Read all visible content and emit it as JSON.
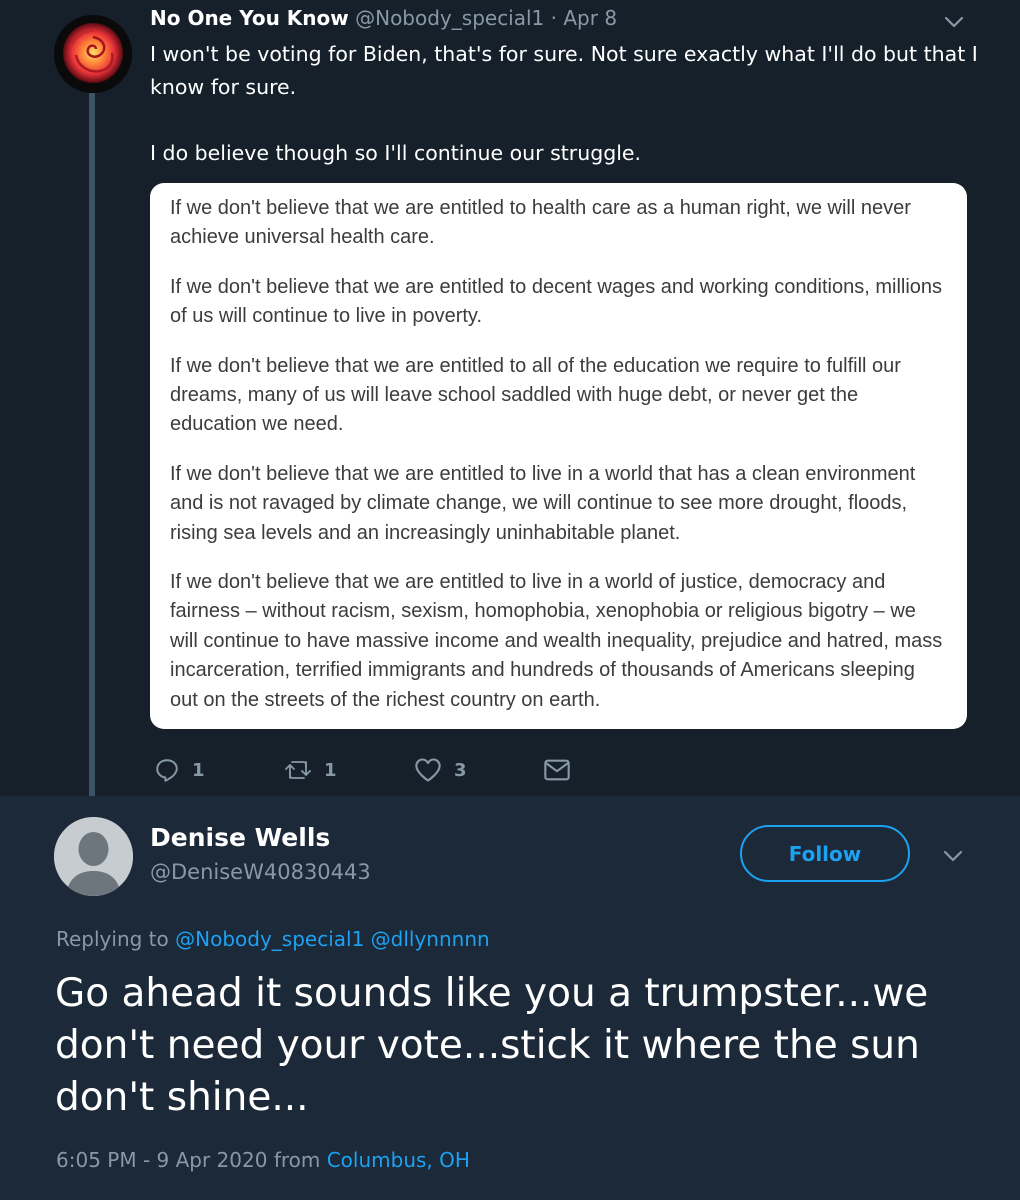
{
  "parent_tweet": {
    "display_name": "No One You Know",
    "handle": "@Nobody_special1",
    "separator": "·",
    "date": "Apr 8",
    "text_lines": [
      "I won't be voting for Biden, that's for sure.  Not sure exactly what I'll do but that I know for sure.",
      "I do believe though so I'll continue our struggle."
    ],
    "quote_paragraphs": [
      "If we don't believe that we are entitled to health care as a human right, we will never achieve universal health care.",
      "If we don't believe that we are entitled to decent wages and working conditions, millions of us will continue to live in poverty.",
      "If we don't believe that we are entitled to all of the education we require to fulfill our dreams, many of us will leave school saddled with huge debt, or never get the education we need.",
      "If we don't believe that we are entitled to live in a world that has a clean environment and is not ravaged by climate change, we will continue to see more drought, floods, rising sea levels and an increasingly uninhabitable planet.",
      "If we don't believe that we are entitled to live in a world of justice, democracy and fairness – without racism, sexism, homophobia, xenophobia or religious bigotry – we will continue to have massive income and wealth inequality, prejudice and hatred, mass incarceration, terrified immigrants and hundreds of thousands of Americans sleeping out on the streets of the richest country on earth."
    ],
    "actions": {
      "reply_icon": "reply-icon",
      "reply_count": "1",
      "retweet_icon": "retweet-icon",
      "retweet_count": "1",
      "like_icon": "heart-icon",
      "like_count": "3",
      "dm_icon": "envelope-icon"
    }
  },
  "main_tweet": {
    "display_name": "Denise Wells",
    "handle": "@DeniseW40830443",
    "follow_label": "Follow",
    "replying_prefix": "Replying to",
    "replying_handle_1": "@Nobody_special1",
    "replying_handle_2": "@dllynnnnn",
    "text": "Go ahead it sounds like you a trumpster...we don't need your vote...stick it where the sun don't shine...",
    "timestamp": "6:05 PM - 9 Apr 2020 from",
    "location": "Columbus, OH"
  },
  "colors": {
    "background": "#15202b",
    "main_background": "#1c2938",
    "accent": "#1da1f2",
    "secondary_text": "#8899a6",
    "thread_line": "#3d5466"
  }
}
